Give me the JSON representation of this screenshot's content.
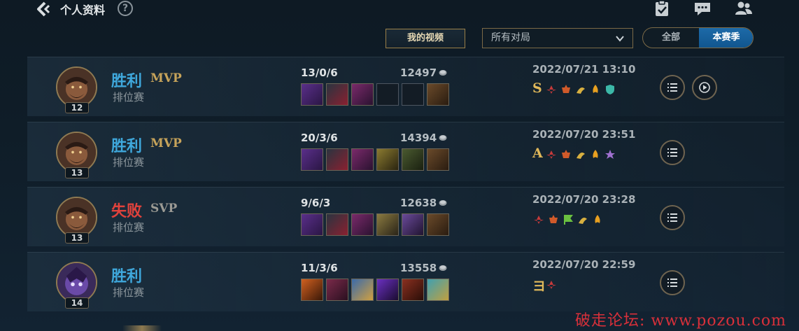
{
  "header": {
    "title": "个人资料",
    "help": "?"
  },
  "filters": {
    "my_video": "我的视频",
    "match_select": "所有对局",
    "seg_all": "全部",
    "seg_season": "本赛季"
  },
  "colors": {
    "win": "#3fa8dc",
    "lose": "#e0423c",
    "gold_badge": "#c6a35a",
    "accent_blue": "#1d6aa8"
  },
  "matches": [
    {
      "result": "胜利",
      "badge": "MVP",
      "mode": "排位赛",
      "level": "12",
      "kda": "13/0/6",
      "gold": "12497",
      "date": "2022/07/21 13:10",
      "grade": "S",
      "items": 6,
      "has_replay": true
    },
    {
      "result": "胜利",
      "badge": "MVP",
      "mode": "排位赛",
      "level": "13",
      "kda": "20/3/6",
      "gold": "14394",
      "date": "2022/07/20 23:51",
      "grade": "A",
      "items": 6,
      "has_replay": false
    },
    {
      "result": "失败",
      "badge": "SVP",
      "mode": "排位赛",
      "level": "13",
      "kda": "9/6/3",
      "gold": "12638",
      "date": "2022/07/20 23:28",
      "grade": "",
      "items": 6,
      "has_replay": false
    },
    {
      "result": "胜利",
      "badge": "",
      "mode": "排位赛",
      "level": "14",
      "kda": "11/3/6",
      "gold": "13558",
      "date": "2022/07/20 22:59",
      "grade": "ヨ",
      "items": 6,
      "has_replay": false
    }
  ],
  "watermark": "破走论坛: www.pozou.com"
}
